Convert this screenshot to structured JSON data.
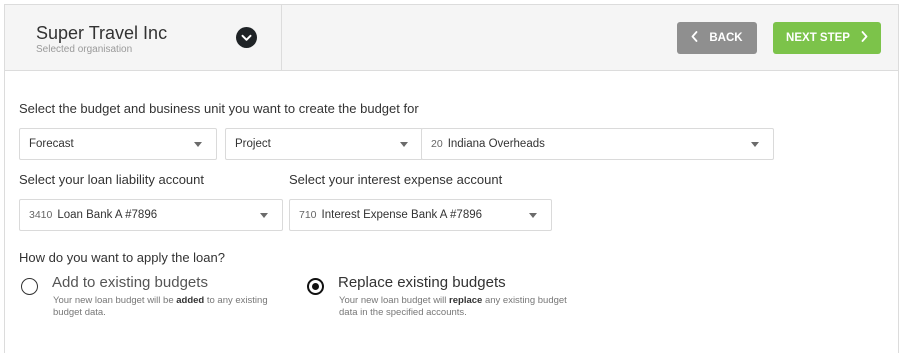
{
  "header": {
    "org_name": "Super Travel Inc",
    "org_subtitle": "Selected organisation",
    "org_toggle_icon": "chevron-down-icon",
    "back_label": "BACK",
    "next_label": "NEXT STEP",
    "back_color": "#8f8f8f",
    "next_color": "#7cc34a"
  },
  "budget_section": {
    "label": "Select the budget and business unit you want to create the budget for",
    "budget_type": "Forecast",
    "unit_type": "Project",
    "unit_code": "20",
    "unit_name": "Indiana Overheads"
  },
  "loan_account": {
    "label": "Select your loan liability account",
    "code": "3410",
    "name": "Loan Bank A #7896"
  },
  "interest_account": {
    "label": "Select your interest expense account",
    "code": "710",
    "name": "Interest Expense Bank A #7896"
  },
  "apply": {
    "question": "How do you want to apply the loan?",
    "options": [
      {
        "title": "Add to existing budgets",
        "desc_pre": "Your new loan budget will be ",
        "desc_bold": "added",
        "desc_post": " to any existing budget data.",
        "checked": false
      },
      {
        "title": "Replace existing budgets",
        "desc_pre": "Your new loan budget will ",
        "desc_bold": "replace",
        "desc_post": " any existing budget data in the specified accounts.",
        "checked": true
      }
    ]
  }
}
